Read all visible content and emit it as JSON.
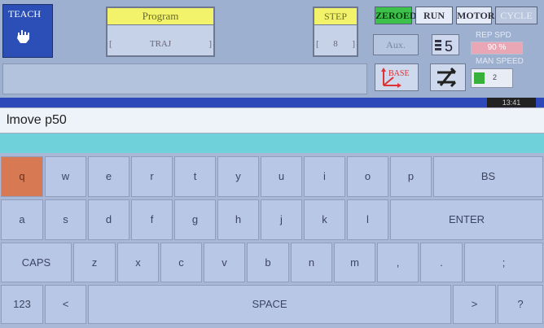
{
  "status": {
    "mode": "TEACH",
    "program_label": "Program",
    "program_value": "TRAJ",
    "step_label": "STEP",
    "step_value": "8",
    "bracket_open": "[",
    "bracket_close": "]",
    "zeroed": "ZEROED",
    "run": "RUN",
    "motor": "MOTOR",
    "cycle": "CYCLE",
    "aux": "Aux.",
    "rep_speed_label": "REP SPD",
    "rep_speed_value": "90 %",
    "man_speed_label": "MAN SPEED",
    "man_speed_value": "2",
    "man_speed_level_fraction": 0.25,
    "clock": "13:41"
  },
  "command": {
    "text": "lmove p50"
  },
  "keyboard": {
    "selected_key": "q",
    "rows": [
      [
        "q",
        "w",
        "e",
        "r",
        "t",
        "y",
        "u",
        "i",
        "o",
        "p",
        "BS"
      ],
      [
        "a",
        "s",
        "d",
        "f",
        "g",
        "h",
        "j",
        "k",
        "l",
        "ENTER"
      ],
      [
        "CAPS",
        "z",
        "x",
        "c",
        "v",
        "b",
        "n",
        "m",
        ",",
        ".",
        ";"
      ],
      [
        "123",
        "<",
        "SPACE",
        ">",
        "?"
      ]
    ]
  },
  "colors": {
    "teach_bg": "#2b4fb7",
    "program_header": "#f2f36a",
    "zeroed_active": "#3cc24a",
    "rep_speed_bg": "#e9a7b6",
    "cyan_bar": "#6fd2db",
    "selected_key": "#d77a53"
  }
}
